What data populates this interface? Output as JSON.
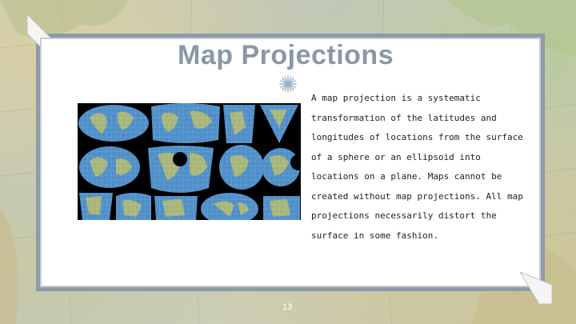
{
  "slide": {
    "title": "Map Projections",
    "body": "A map projection is a systematic transformation of the latitudes and longitudes of locations from the surface of a sphere or an ellipsoid into locations on a plane. Maps cannot be created without map projections. All map projections necessarily distort the surface in some fashion.",
    "page_number": "13"
  },
  "image": {
    "description_icon": "map-projections-collage",
    "colors": {
      "ocean": "#4f8fc9",
      "land": "#a7b57a",
      "background": "#000000"
    }
  },
  "colors": {
    "title": "#8a97a5",
    "card_border": "#c8ced6",
    "card_shadow": "#8e9aa6",
    "body_text": "#1e1e1e"
  }
}
